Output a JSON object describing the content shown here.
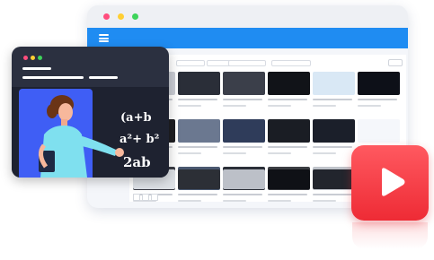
{
  "window": {
    "dots": [
      "#ff4d7d",
      "#ffcf33",
      "#3ed45b"
    ],
    "appbar_color": "#1f8cf2",
    "menu_icon": "hamburger-menu-icon"
  },
  "toolbar": {
    "search_placeholder": "",
    "filter_label": "",
    "action_label": ""
  },
  "videos": {
    "rows": [
      {
        "thumbs": [
          "#c9ccd4",
          "#2a2e38",
          "#3b3f4a",
          "#111318",
          "#d9e8f5",
          "#0d1018"
        ]
      },
      {
        "thumbs": [
          "#1e1e22",
          "#6b7890",
          "#2f3c5a",
          "#1a1d24",
          "#1b1f2a",
          "#f5f7fb"
        ]
      },
      {
        "thumbs": [
          "#3a3c45",
          "#4a5870",
          "#2b2f38",
          "#3b3d42",
          "#bfc3ca",
          "#5a6e5a"
        ]
      },
      {
        "thumbs": [
          "#dde1e6",
          "#2c2f36",
          "#bcc0c8",
          "#0f1116",
          "#22252d",
          "#2a2d35"
        ]
      }
    ]
  },
  "card": {
    "dots": [
      "#ff4d7d",
      "#ffcf33",
      "#3ed45b"
    ],
    "math_line1": "(a+b",
    "math_line2": "a²+ b²",
    "math_line3": "2ab"
  },
  "play": {
    "icon": "play-icon",
    "color": "#ee2b35"
  }
}
